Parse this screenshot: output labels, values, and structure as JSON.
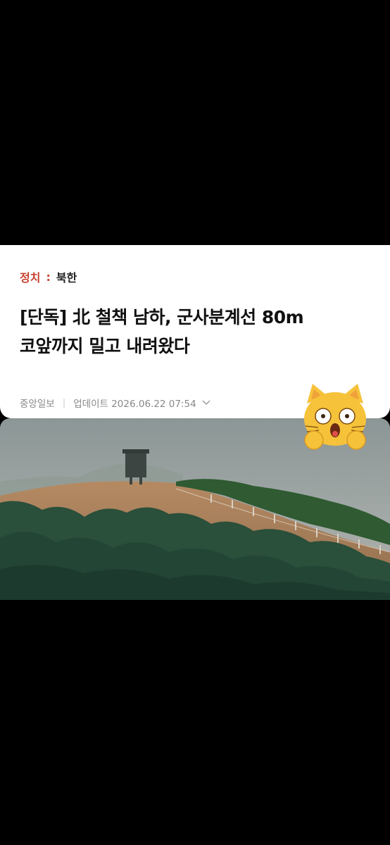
{
  "article": {
    "category": "정치",
    "separator": ":",
    "subcategory": "북한",
    "headline": "[단독] 北 철책 남하, 군사분계선 80m\n코앞까지 밀고 내려왔다",
    "publisher": "중앙일보",
    "meta_divider": "|",
    "updated": "업데이트 2026.06.22 07:54"
  },
  "icons": {
    "expand": "chevron-down-icon",
    "sticker": "shocked-cat-emoji"
  },
  "colors": {
    "background": "#000000",
    "card": "#ffffff",
    "category": "#c8432f",
    "headline": "#111111",
    "meta": "#888888"
  }
}
